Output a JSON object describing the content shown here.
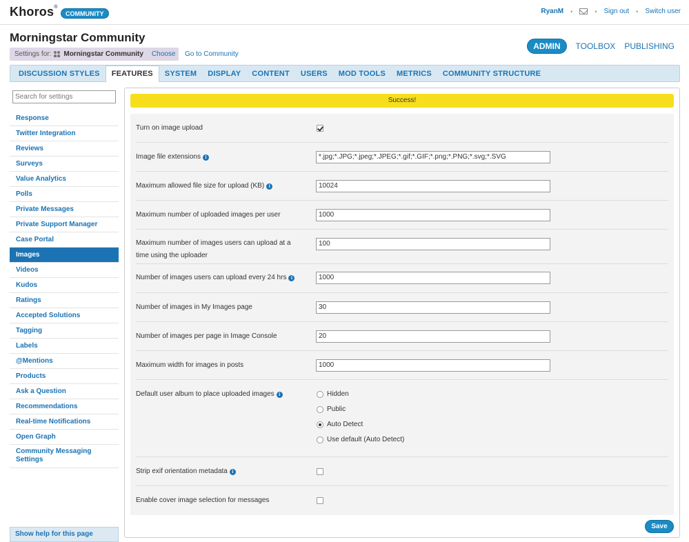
{
  "brand": {
    "logo": "Khoros",
    "badge": "COMMUNITY"
  },
  "user_nav": {
    "user": "RyanM",
    "sign_out": "Sign out",
    "switch_user": "Switch user"
  },
  "header": {
    "title": "Morningstar Community",
    "settings_for_label": "Settings for:",
    "settings_for_name": "Morningstar Community",
    "choose": "Choose",
    "go_to_community": "Go to Community"
  },
  "top_tabs": [
    {
      "label": "ADMIN",
      "active": true
    },
    {
      "label": "TOOLBOX",
      "active": false
    },
    {
      "label": "PUBLISHING",
      "active": false
    }
  ],
  "tabs": [
    {
      "label": "DISCUSSION STYLES",
      "active": false
    },
    {
      "label": "FEATURES",
      "active": true
    },
    {
      "label": "SYSTEM",
      "active": false
    },
    {
      "label": "DISPLAY",
      "active": false
    },
    {
      "label": "CONTENT",
      "active": false
    },
    {
      "label": "USERS",
      "active": false
    },
    {
      "label": "MOD TOOLS",
      "active": false
    },
    {
      "label": "METRICS",
      "active": false
    },
    {
      "label": "COMMUNITY STRUCTURE",
      "active": false
    }
  ],
  "sidebar": {
    "search_placeholder": "Search for settings",
    "items": [
      "Response",
      "Twitter Integration",
      "Reviews",
      "Surveys",
      "Value Analytics",
      "Polls",
      "Private Messages",
      "Private Support Manager",
      "Case Portal",
      "Images",
      "Videos",
      "Kudos",
      "Ratings",
      "Accepted Solutions",
      "Tagging",
      "Labels",
      "@Mentions",
      "Products",
      "Ask a Question",
      "Recommendations",
      "Real-time Notifications",
      "Open Graph",
      "Community Messaging Settings"
    ],
    "active_item": "Images",
    "help_link": "Show help for this page"
  },
  "main": {
    "success_message": "Success!",
    "settings": {
      "turn_on_upload": {
        "label": "Turn on image upload",
        "checked": true
      },
      "file_extensions": {
        "label": "Image file extensions",
        "value": "*.jpg;*.JPG;*.jpeg;*.JPEG;*.gif;*.GIF;*.png;*.PNG;*.svg;*.SVG"
      },
      "max_file_size": {
        "label": "Maximum allowed file size for upload (KB)",
        "value": "10024"
      },
      "max_images_per_user": {
        "label": "Maximum number of uploaded images per user",
        "value": "1000"
      },
      "max_at_a_time": {
        "label": "Maximum number of images users can upload at a time using the uploader",
        "value": "100"
      },
      "per_24_hrs": {
        "label": "Number of images users can upload every 24 hrs",
        "value": "1000"
      },
      "my_images_page": {
        "label": "Number of images in My Images page",
        "value": "30"
      },
      "image_console": {
        "label": "Number of images per page in Image Console",
        "value": "20"
      },
      "max_width": {
        "label": "Maximum width for images in posts",
        "value": "1000"
      },
      "default_album": {
        "label": "Default user album to place uploaded images",
        "options": [
          "Hidden",
          "Public",
          "Auto Detect",
          "Use default (Auto Detect)"
        ],
        "selected": "Auto Detect"
      },
      "strip_exif": {
        "label": "Strip exif orientation metadata",
        "checked": false
      },
      "cover_image": {
        "label": "Enable cover image selection for messages",
        "checked": false
      }
    },
    "save_label": "Save"
  },
  "colors": {
    "brand_blue": "#1b8bc5",
    "link_blue": "#1b73b3",
    "success_yellow": "#f7de1c"
  }
}
